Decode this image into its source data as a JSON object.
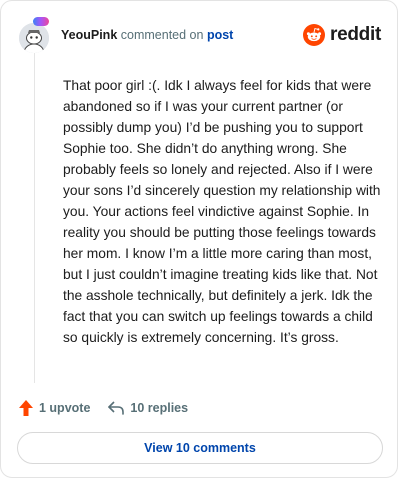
{
  "header": {
    "username": "YeouPink",
    "action_text": "commented on",
    "post_link": "post",
    "brand_wordmark": "reddit"
  },
  "comment": {
    "body": "That poor girl :(. Idk I always feel for kids that were abandoned so if I was your current partner (or possibly dump you) I’d be pushing you to support Sophie too. She didn’t do anything wrong. She probably feels so lonely and rejected. Also if I were your sons I’d sincerely question my relationship with you. Your actions feel vindictive against Sophie. In reality you should be putting those feelings towards her mom. I know I’m a little more caring than most, but I just couldn’t imagine treating kids like that. Not the asshole technically, but definitely a jerk. Idk the fact that you can switch up feelings towards a child so quickly is extremely concerning. It’s gross."
  },
  "actions": {
    "upvote_label": "1 upvote",
    "replies_label": "10 replies"
  },
  "footer": {
    "view_comments_label": "View 10 comments"
  },
  "colors": {
    "upvote": "#ff4500",
    "link": "#0045ac",
    "muted": "#576f76",
    "brand": "#ff4500"
  },
  "icons": {
    "avatar": "snoo-avatar-icon",
    "brand": "reddit-logo-icon",
    "upvote": "upvote-arrow-icon",
    "reply": "reply-arrow-icon"
  }
}
